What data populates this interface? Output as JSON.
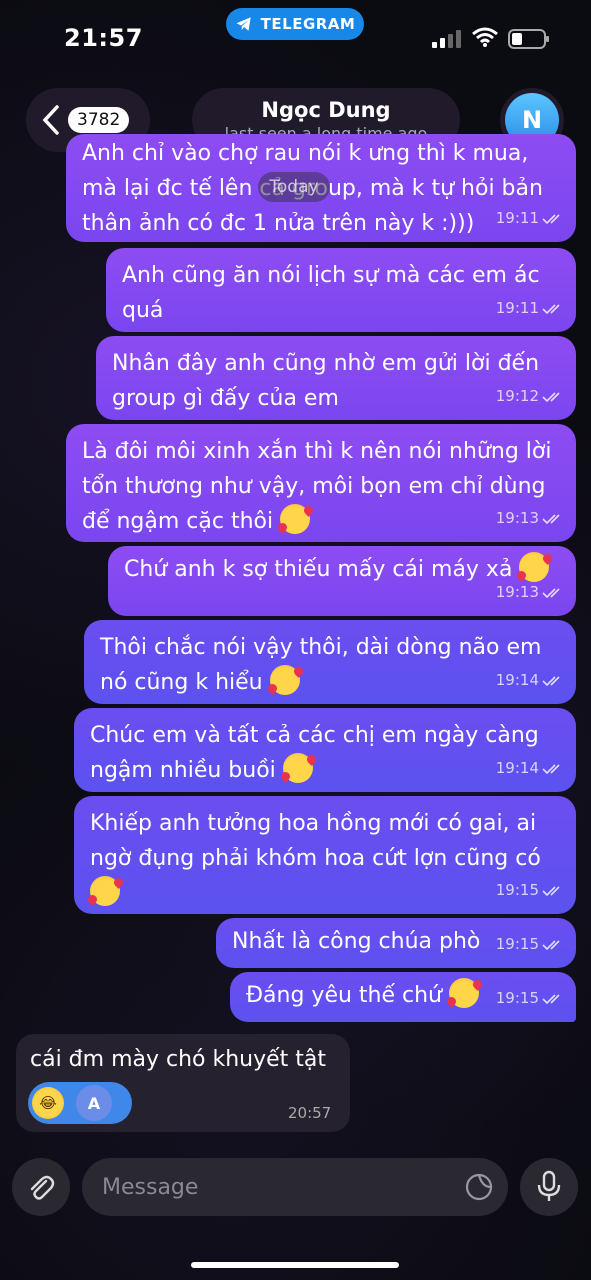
{
  "status": {
    "time": "21:57",
    "app_pill": "TELEGRAM"
  },
  "header": {
    "back_count": "3782",
    "name": "Ngọc Dung",
    "last_seen": "last seen a long time ago",
    "avatar_letter": "N"
  },
  "date_separator": "Today",
  "messages": [
    {
      "lines": [
        "Anh chỉ vào chợ rau nói k ưng thì k mua,",
        "mà lại đc tế lên cả group, mà k tự hỏi bản",
        "thân ảnh có đc 1 nửa trên này k :)))"
      ],
      "time": "19:11",
      "emoji": false
    },
    {
      "lines": [
        "Anh cũng ăn nói lịch sự mà các em ác",
        "quá"
      ],
      "time": "19:11",
      "emoji": false
    },
    {
      "lines": [
        "Nhân đây anh cũng nhờ em gửi lời đến",
        "group gì đấy của em"
      ],
      "time": "19:12",
      "emoji": false
    },
    {
      "lines": [
        "Là đôi môi xinh xắn thì k nên nói những lời",
        "tổn thương như vậy, môi bọn em chỉ dùng",
        "để ngậm cặc thôi"
      ],
      "time": "19:13",
      "emoji": true
    },
    {
      "lines": [
        "Chứ anh k sợ thiếu mấy cái máy xả"
      ],
      "time": "19:13",
      "emoji": true
    },
    {
      "lines": [
        "Thôi chắc nói vậy thôi, dài dòng não em",
        "nó cũng k hiểu"
      ],
      "time": "19:14",
      "emoji": true
    },
    {
      "lines": [
        "Chúc em và tất cả các chị em ngày càng",
        "ngậm nhiều buồi"
      ],
      "time": "19:14",
      "emoji": true
    },
    {
      "lines": [
        "Khiếp anh tưởng hoa hồng mới có gai, ai",
        "ngờ đụng phải khóm hoa cứt lợn cũng có",
        ""
      ],
      "time": "19:15",
      "emoji": true
    },
    {
      "lines": [
        "Nhất là công chúa phò"
      ],
      "time": "19:15",
      "emoji": false
    },
    {
      "lines": [
        "Đáng yêu thế chứ"
      ],
      "time": "19:15",
      "emoji": true
    }
  ],
  "incoming": {
    "text": "cái đm mày chó khuyết tật",
    "time": "20:57",
    "reaction_emoji": "laughing-emoji",
    "reaction_avatar": "A"
  },
  "composer": {
    "placeholder": "Message"
  }
}
